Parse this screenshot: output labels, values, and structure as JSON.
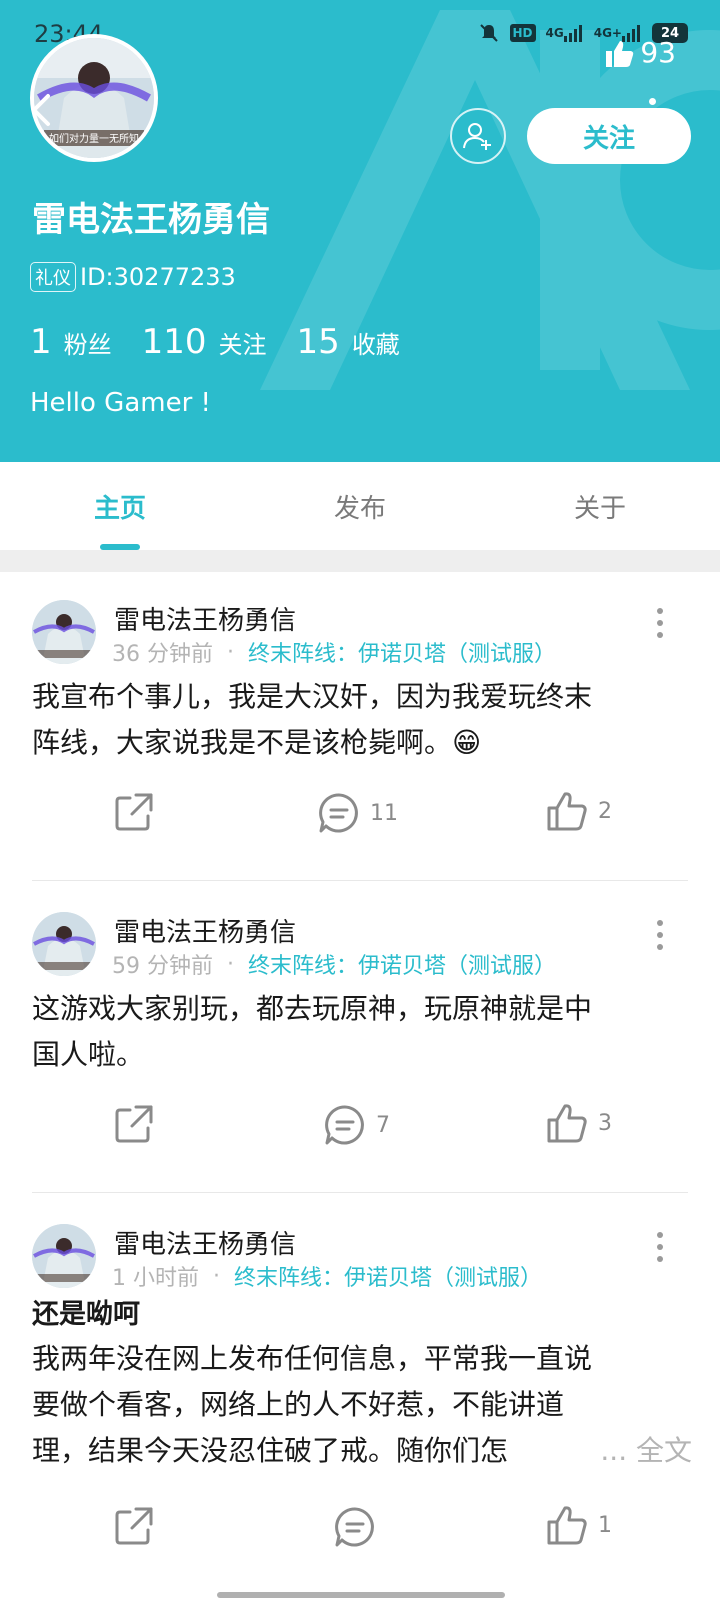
{
  "status_bar": {
    "time": "23:44",
    "time_suffix": "¹̆",
    "network_labels": [
      "HD",
      "4G",
      "4G+"
    ],
    "battery": "24"
  },
  "header": {
    "likes_count": "93",
    "follow_label": "关注",
    "name": "雷电法王杨勇信",
    "badge": "礼仪",
    "id_text": "ID:30277233",
    "bio": "Hello Gamer !",
    "avatar_caption": "如们对力量一无所知",
    "stats": [
      {
        "value": "1",
        "label": "粉丝"
      },
      {
        "value": "110",
        "label": "关注"
      },
      {
        "value": "15",
        "label": "收藏"
      }
    ]
  },
  "tabs": [
    {
      "label": "主页",
      "active": true
    },
    {
      "label": "发布",
      "active": false
    },
    {
      "label": "关于",
      "active": false
    }
  ],
  "posts": [
    {
      "author": "雷电法王杨勇信",
      "time": "36 分钟前",
      "source": "终末阵线：伊诺贝塔（测试服）",
      "title": "",
      "body_lines": [
        "我宣布个事儿，我是大汉奸，因为我爱玩终末",
        "阵线，大家说我是不是该枪毙啊。😁"
      ],
      "expand_label": "",
      "comments": "11",
      "likes": "2"
    },
    {
      "author": "雷电法王杨勇信",
      "time": "59 分钟前",
      "source": "终末阵线：伊诺贝塔（测试服）",
      "title": "",
      "body_lines": [
        "这游戏大家别玩，都去玩原神，玩原神就是中",
        "国人啦。"
      ],
      "expand_label": "",
      "comments": "7",
      "likes": "3"
    },
    {
      "author": "雷电法王杨勇信",
      "time": "1 小时前",
      "source": "终末阵线：伊诺贝塔（测试服）",
      "title": "还是呦呵",
      "body_lines": [
        "我两年没在网上发布任何信息，平常我一直说",
        "要做个看客，网络上的人不好惹，不能讲道",
        "理，结果今天没忍住破了戒。随你们怎"
      ],
      "expand_label": "... 全文",
      "comments": "",
      "likes": "1"
    }
  ],
  "colors": {
    "accent": "#2bbccc",
    "muted": "#b4b4b4"
  }
}
